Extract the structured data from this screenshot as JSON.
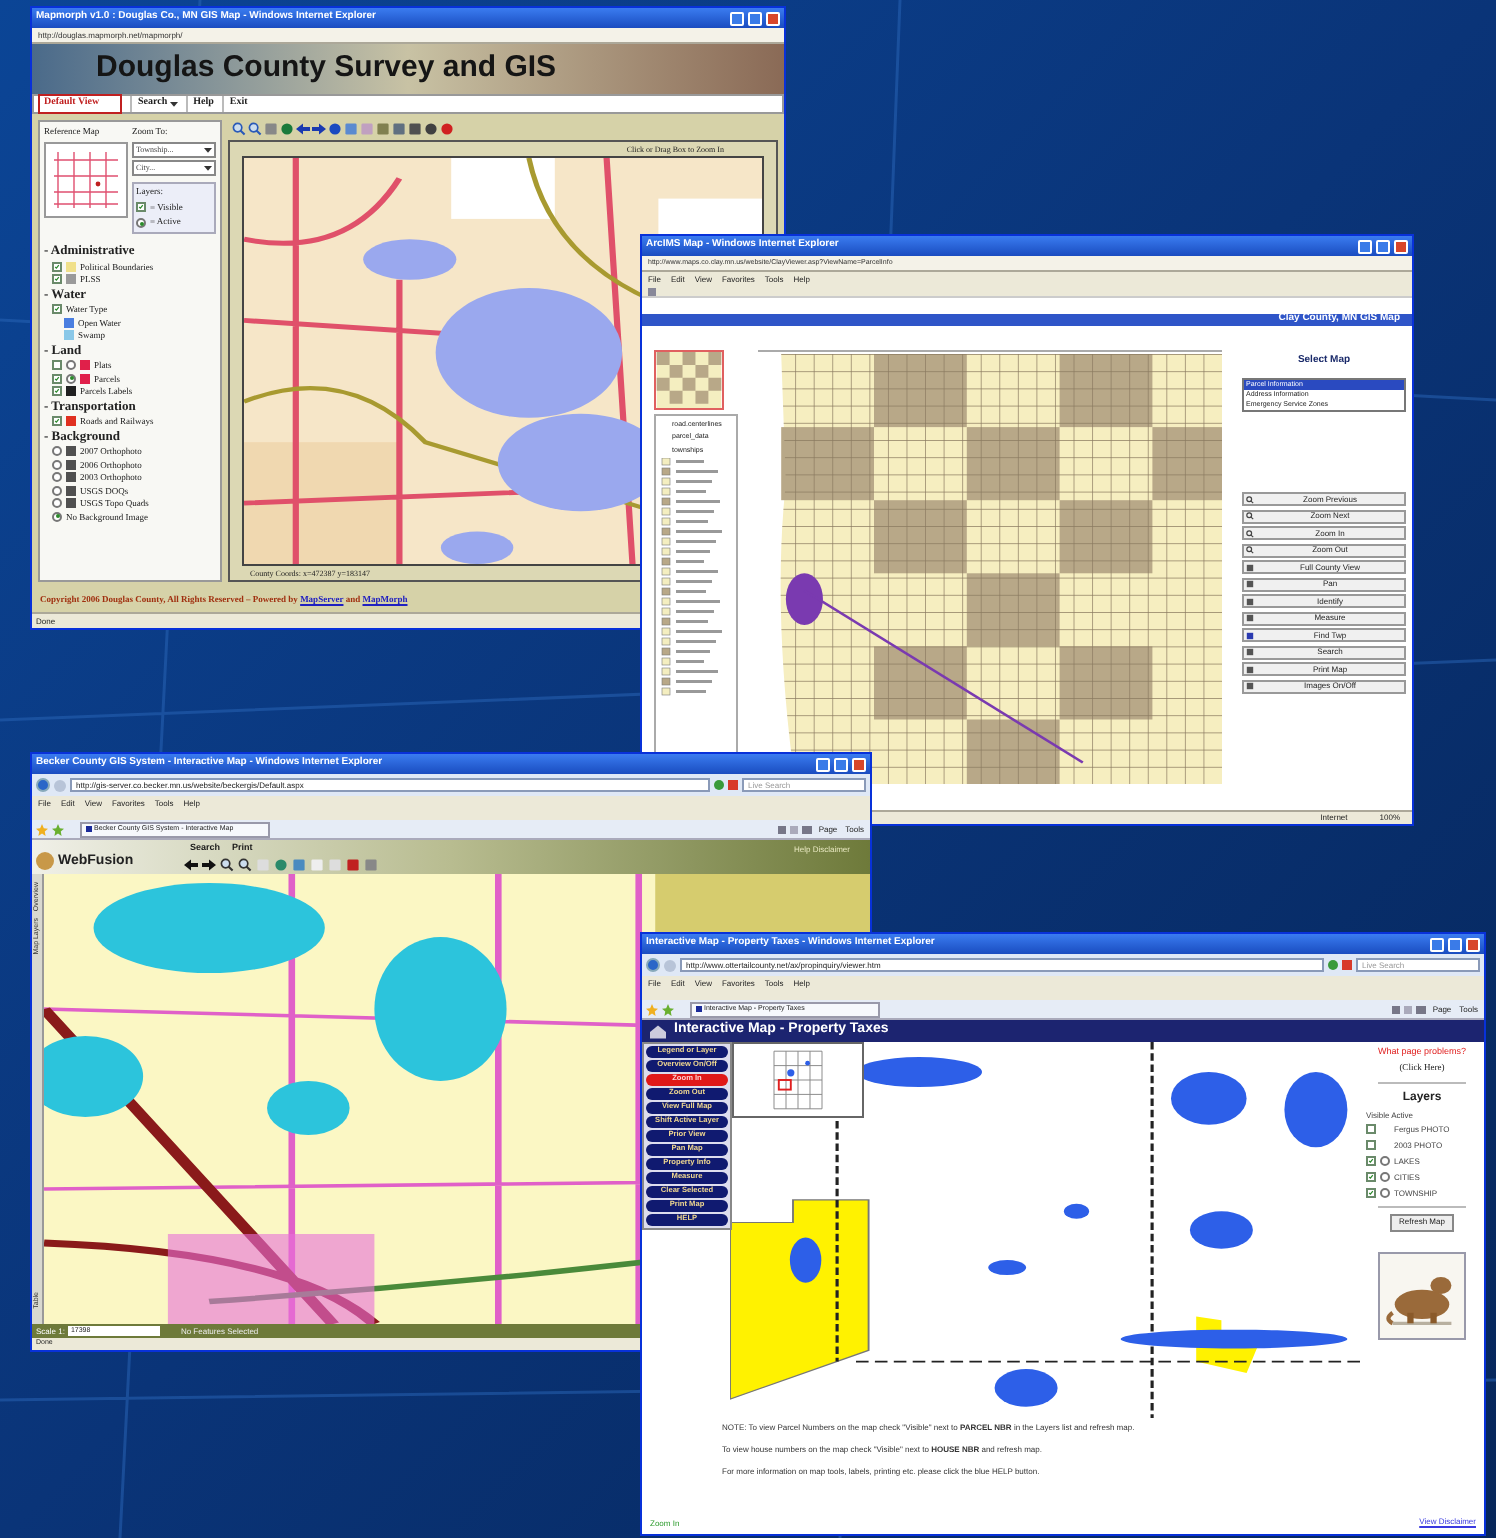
{
  "douglas_window": {
    "title": "Mapmorph v1.0 : Douglas Co., MN GIS Map - Windows Internet Explorer",
    "address": "http://douglas.mapmorph.net/mapmorph/",
    "banner": "Douglas County Survey and GIS",
    "view_select": "Default View",
    "menu": [
      "Search",
      "Help",
      "Exit"
    ],
    "reference_map": "Reference Map",
    "zoom_to": {
      "label": "Zoom To:",
      "selects": [
        "Township...",
        "City..."
      ]
    },
    "layers_key": {
      "label": "Layers:",
      "items": [
        {
          "kind": "checkbox",
          "text": "= Visible"
        },
        {
          "kind": "radio",
          "text": "= Active"
        }
      ]
    },
    "layer_groups": [
      {
        "name": "- Administrative",
        "layers": [
          {
            "kind": "checkbox",
            "label": "Political Boundaries",
            "checked": true,
            "color": "#f0e08a"
          },
          {
            "kind": "checkbox",
            "label": "PLSS",
            "checked": true,
            "color": "#9a9a9a"
          }
        ]
      },
      {
        "name": "- Water",
        "layers": [
          {
            "kind": "checkbox",
            "label": "Water Type",
            "checked": true
          },
          {
            "kind": "legend",
            "label": "Open Water",
            "color": "#4a7ee0"
          },
          {
            "kind": "legend",
            "label": "Swamp",
            "color": "#8ac8e8"
          }
        ]
      },
      {
        "name": "- Land",
        "layers": [
          {
            "kind": "checkbox_active",
            "label": "Plats",
            "checked": false,
            "active": false,
            "color": "#e0204a"
          },
          {
            "kind": "checkbox_active",
            "label": "Parcels",
            "checked": true,
            "active": true,
            "color": "#e0204a"
          },
          {
            "kind": "checkbox",
            "label": "Parcels Labels",
            "checked": true,
            "color": "#202020"
          }
        ]
      },
      {
        "name": "- Transportation",
        "layers": [
          {
            "kind": "checkbox",
            "label": "Roads and Railways",
            "checked": true,
            "color": "#e03020"
          }
        ]
      },
      {
        "name": "- Background",
        "layers": [
          {
            "kind": "radio",
            "label": "2007 Orthophoto",
            "selected": false,
            "color": "#505050"
          },
          {
            "kind": "radio",
            "label": "2006 Orthophoto",
            "selected": false,
            "color": "#505050"
          },
          {
            "kind": "radio",
            "label": "2003 Orthophoto",
            "selected": false,
            "color": "#505050"
          },
          {
            "kind": "radio",
            "label": "USGS DOQs",
            "selected": false,
            "color": "#505050"
          },
          {
            "kind": "radio",
            "label": "USGS Topo Quads",
            "selected": false,
            "color": "#505050"
          },
          {
            "kind": "radio",
            "label": "No Background Image",
            "selected": true
          }
        ]
      }
    ],
    "map_hint": "Click or Drag Box to Zoom In",
    "coords": "County Coords: x=472387 y=183147",
    "copyright": {
      "text": "Copyright 2006 Douglas County, All Rights Reserved – Powered by",
      "links": [
        "MapServer",
        "MapMorph"
      ],
      "joiner": "and"
    },
    "status": "Done"
  },
  "clay_window": {
    "title": "ArcIMS Map - Windows Internet Explorer",
    "address": "http://www.maps.co.clay.mn.us/website/ClayViewer.asp?ViewName=ParcelInfo",
    "menu": [
      "File",
      "Edit",
      "View",
      "Favorites",
      "Tools",
      "Help"
    ],
    "header": "Clay County, MN GIS Map",
    "legend": [
      "road.centerlines",
      "parcel_data",
      "townships"
    ],
    "select_map": {
      "label": "Select Map",
      "options": [
        {
          "label": "Parcel Information",
          "selected": true
        },
        {
          "label": "Address Information",
          "selected": false
        },
        {
          "label": "Emergency Service Zones",
          "selected": false
        }
      ]
    },
    "tools": [
      "Zoom Previous",
      "Zoom Next",
      "Zoom In",
      "Zoom Out",
      "Full County View",
      "Pan",
      "Identify",
      "Measure",
      "Find Twp",
      "Search",
      "Print Map",
      "Images On/Off"
    ],
    "status": [
      "Internet",
      "100%"
    ]
  },
  "becker_window": {
    "title": "Becker County GIS System - Interactive Map - Windows Internet Explorer",
    "address": "http://gis-server.co.becker.mn.us/website/beckergis/Default.aspx",
    "search_placeholder": "Live Search",
    "menu": [
      "File",
      "Edit",
      "View",
      "Favorites",
      "Tools",
      "Help"
    ],
    "tab": "Becker County GIS System - Interactive Map",
    "command_menus": [
      "Page",
      "Tools"
    ],
    "logo": "WebFusion",
    "header_links": [
      "Search",
      "Print"
    ],
    "disclaimer": "Help Disclaimer",
    "side_tabs": [
      "Overview",
      "Map Layers",
      "Table"
    ],
    "scale_label": "Scale 1:",
    "scale_value": "17398",
    "selection_status": "No Features Selected",
    "status": "Done"
  },
  "otter_tail_window": {
    "title": "Interactive Map - Property Taxes - Windows Internet Explorer",
    "address": "http://www.ottertailcounty.net/ax/propinquiry/viewer.htm",
    "search_placeholder": "Live Search",
    "menu": [
      "File",
      "Edit",
      "View",
      "Favorites",
      "Tools",
      "Help"
    ],
    "tab": "Interactive Map - Property Taxes",
    "command_menus": [
      "Page",
      "Tools"
    ],
    "header": "Interactive Map - Property Taxes",
    "tools": [
      {
        "label": "Legend or Layer",
        "selected": false
      },
      {
        "label": "Overview On/Off",
        "selected": false
      },
      {
        "label": "Zoom In",
        "selected": true
      },
      {
        "label": "Zoom Out",
        "selected": false
      },
      {
        "label": "View Full Map",
        "selected": false
      },
      {
        "label": "Shift Active Layer",
        "selected": false
      },
      {
        "label": "Prior View",
        "selected": false
      },
      {
        "label": "Pan Map",
        "selected": false
      },
      {
        "label": "Property Info",
        "selected": false
      },
      {
        "label": "Measure",
        "selected": false
      },
      {
        "label": "Clear Selected",
        "selected": false
      },
      {
        "label": "Print Map",
        "selected": false
      },
      {
        "label": "HELP",
        "selected": false
      }
    ],
    "problems_link": "What page problems?",
    "click_here": "(Click Here)",
    "layers": {
      "title": "Layers",
      "caption": "Visible Active",
      "items": [
        {
          "label": "Fergus PHOTO",
          "checked": false,
          "radio": false
        },
        {
          "label": "2003 PHOTO",
          "checked": false,
          "radio": false
        },
        {
          "label": "LAKES",
          "checked": true,
          "radio": true
        },
        {
          "label": "CITIES",
          "checked": true,
          "radio": true
        },
        {
          "label": "TOWNSHIP",
          "checked": true,
          "radio": true
        }
      ]
    },
    "refresh": "Refresh Map",
    "notes": [
      "NOTE: To view Parcel Numbers on the map check \"Visible\" next to **PARCEL NBR** in the Layers list and refresh map.",
      "To view house numbers on the map check \"Visible\" next to **HOUSE NBR** and refresh map.",
      "For more information on map tools, labels, printing etc. please click the blue HELP button."
    ],
    "status": "Zoom In",
    "disclaimer": "View Disclaimer"
  }
}
